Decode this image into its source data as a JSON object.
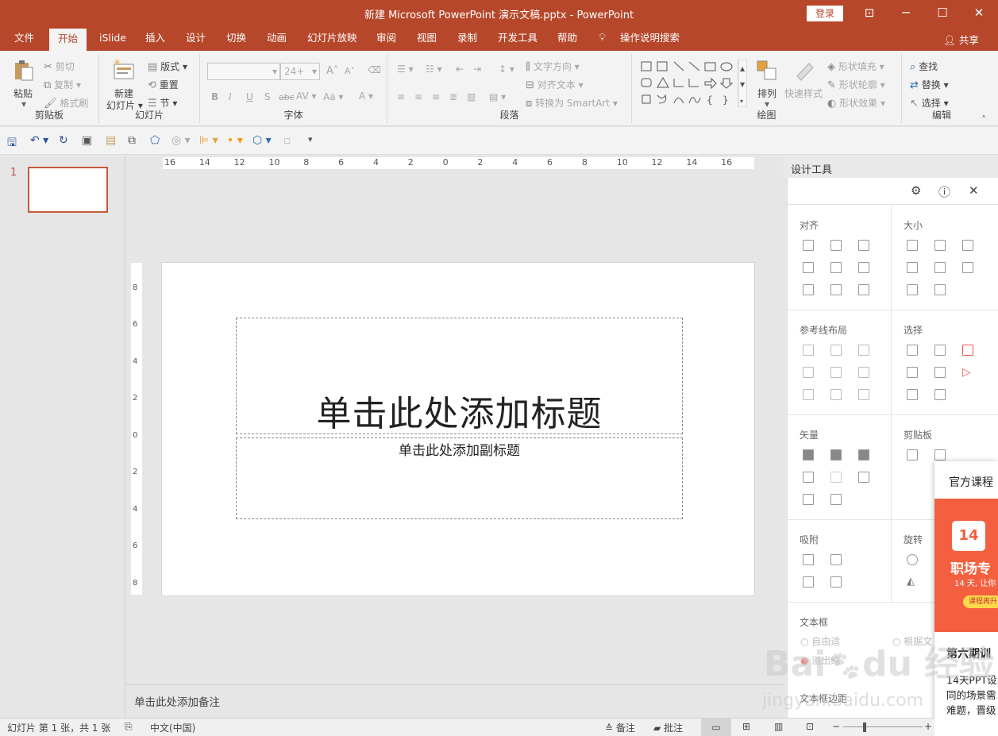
{
  "window": {
    "title": "新建 Microsoft PowerPoint 演示文稿.pptx  -  PowerPoint",
    "login": "登录"
  },
  "tabs": [
    "文件",
    "开始",
    "iSlide",
    "插入",
    "设计",
    "切换",
    "动画",
    "幻灯片放映",
    "审阅",
    "视图",
    "录制",
    "开发工具",
    "帮助"
  ],
  "tell_me": "操作说明搜索",
  "share": "共享",
  "ribbon": {
    "clipboard": {
      "label": "剪贴板",
      "paste": "粘贴",
      "cut": "剪切",
      "copy": "复制",
      "format_painter": "格式刷"
    },
    "slides": {
      "label": "幻灯片",
      "new_slide_1": "新建",
      "new_slide_2": "幻灯片",
      "layout": "版式",
      "reset": "重置",
      "section": "节"
    },
    "font": {
      "label": "字体",
      "size": "24+",
      "aa": "Aa"
    },
    "paragraph": {
      "label": "段落",
      "text_direction": "文字方向",
      "align_text": "对齐文本",
      "smartart": "转换为 SmartArt"
    },
    "drawing": {
      "label": "绘图",
      "arrange": "排列",
      "quick_styles": "快速样式",
      "shape_fill": "形状填充",
      "shape_outline": "形状轮廓",
      "shape_effects": "形状效果"
    },
    "editing": {
      "label": "编辑",
      "find": "查找",
      "replace": "替换",
      "select": "选择"
    }
  },
  "thumbs": {
    "number": "1"
  },
  "ruler": {
    "h": [
      "16",
      "14",
      "12",
      "10",
      "8",
      "6",
      "4",
      "2",
      "0",
      "2",
      "4",
      "6",
      "8",
      "10",
      "12",
      "14",
      "16"
    ],
    "v": [
      "8",
      "6",
      "4",
      "2",
      "0",
      "2",
      "4",
      "6",
      "8"
    ]
  },
  "slide": {
    "title": "单击此处添加标题",
    "subtitle": "单击此处添加副标题"
  },
  "notes": "单击此处添加备注",
  "design_tools": {
    "header": "设计工具",
    "sections": {
      "align": "对齐",
      "size": "大小",
      "guides": "参考线布局",
      "select": "选择",
      "vector": "矢量",
      "clipboard": "剪贴板",
      "snap": "吸附",
      "rotate": "旋转",
      "textbox": "文本框",
      "auto_fit": "自由适",
      "fit_text": "根据文",
      "shrink": "溢出缩",
      "textbox_margin": "文本框边距"
    }
  },
  "ad": {
    "header": "官方课程",
    "cal_num": "14",
    "banner_title": "职场专",
    "banner_sub": "14 天, 让你",
    "banner_btn": "课程再升",
    "title": "第六期训",
    "body": [
      "14天PPT设",
      "同的场景需",
      "难题，晋级"
    ]
  },
  "status": {
    "slide_info": "幻灯片 第 1 张，共 1 张",
    "language": "中文(中国)",
    "notes": "备注",
    "comments": "批注"
  },
  "watermark": {
    "main": "Bai du 经验",
    "url": "jingyan.baidu.com"
  },
  "colors": {
    "accent": "#b7472a",
    "selection": "#c55a3b",
    "ad_banner": "#f4603f"
  }
}
